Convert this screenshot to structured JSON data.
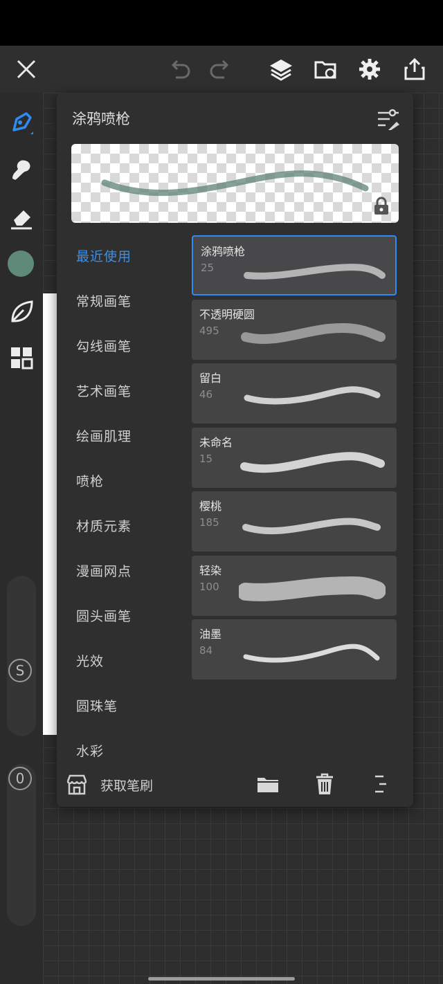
{
  "panel": {
    "title": "涂鸦喷枪",
    "get_brushes_label": "获取笔刷"
  },
  "categories": [
    {
      "label": "最近使用",
      "active": true
    },
    {
      "label": "常规画笔"
    },
    {
      "label": "勾线画笔"
    },
    {
      "label": "艺术画笔"
    },
    {
      "label": "绘画肌理"
    },
    {
      "label": "喷枪"
    },
    {
      "label": "材质元素"
    },
    {
      "label": "漫画网点"
    },
    {
      "label": "圆头画笔"
    },
    {
      "label": "光效"
    },
    {
      "label": "圆珠笔"
    },
    {
      "label": "水彩"
    }
  ],
  "brushes": [
    {
      "name": "涂鸦喷枪",
      "size": "25",
      "selected": true
    },
    {
      "name": "不透明硬圆",
      "size": "495"
    },
    {
      "name": "留白",
      "size": "46"
    },
    {
      "name": "未命名",
      "size": "15"
    },
    {
      "name": "樱桃",
      "size": "185"
    },
    {
      "name": "轻染",
      "size": "100"
    },
    {
      "name": "油墨",
      "size": "84"
    }
  ],
  "rail": {
    "size_slider_label": "S",
    "opacity_slider_label": "0"
  },
  "colors": {
    "accent": "#2f8cf0",
    "current_color": "#5e8a77",
    "preview_stroke": "#5d8374"
  }
}
